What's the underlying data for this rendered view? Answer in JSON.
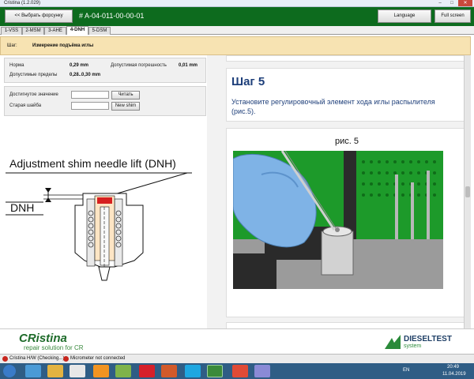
{
  "window": {
    "title": "Cristina (1.2.029)"
  },
  "header": {
    "back_button": "<< Выбрать форсунку",
    "injector_id": "# A-04-011-00-00-01",
    "language_button": "Language",
    "fullscreen_button": "Full screen"
  },
  "tabs": [
    "1-VSS",
    "2-MSM",
    "3-AHE",
    "4-DNH",
    "5-DSM"
  ],
  "step_bar": {
    "label": "Шаг:",
    "value": "Измерение подъёма иглы"
  },
  "params": {
    "norm_label": "Норма",
    "norm_value": "0,29 mm",
    "tolerance_label": "Допустимая погрешность",
    "tolerance_value": "0,01 mm",
    "limits_label": "Допустимые пределы",
    "limits_value": "0,28..0,30 mm"
  },
  "form": {
    "achieved_label": "Достигнутое значение",
    "achieved_value": "",
    "read_button": "Читать",
    "old_shim_label": "Старая шайба",
    "old_shim_value": "",
    "new_shim_button": "New shim"
  },
  "diagram": {
    "title": "Adjustment shim needle lift (DNH)",
    "dnh_label": "DNH"
  },
  "instruction": {
    "heading": "Шаг 5",
    "text": "Установите регулировочный элемент хода иглы распылителя (рис.5).",
    "figure_caption": "рис. 5"
  },
  "footer": {
    "brand": "CRistina",
    "brand_tagline": "repair solution for CR",
    "partner_logo": "DIESELTEST",
    "partner_sub": "system"
  },
  "status_bar": {
    "item1": "Cristina H/W (Checking...)",
    "item2": "Micrometer not connected"
  },
  "taskbar": {
    "lang": "EN",
    "time": "20:49",
    "date": "11.04.2019"
  }
}
